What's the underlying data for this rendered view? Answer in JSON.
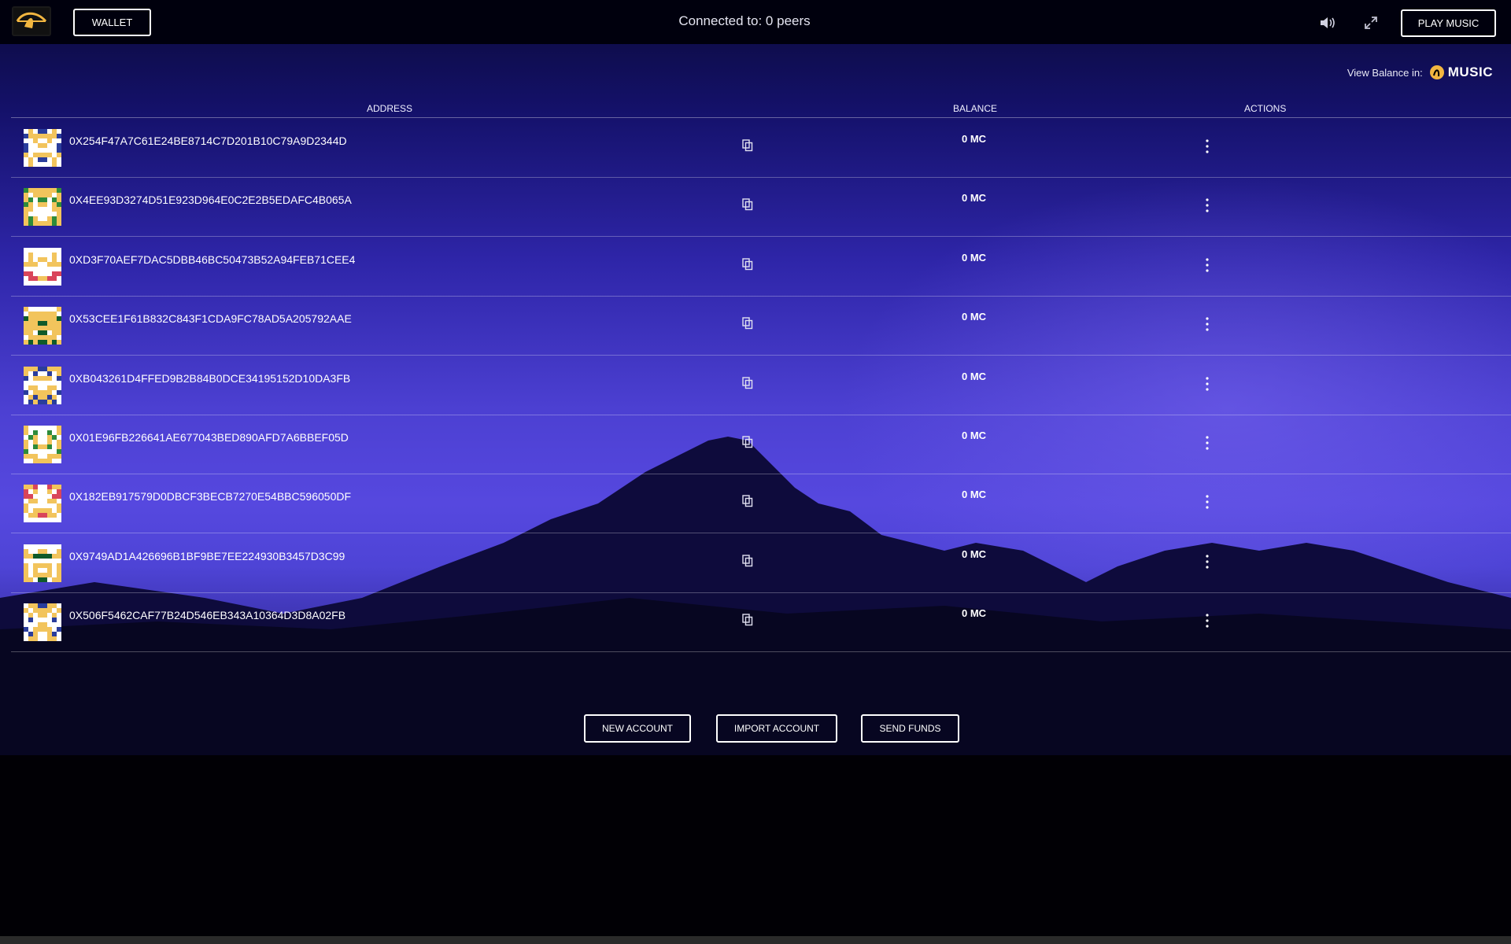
{
  "topbar": {
    "wallet_label": "WALLET",
    "peers_text": "Connected to: 0 peers",
    "play_label": "PLAY MUSIC",
    "logo_icon": "musicoin-logo-icon",
    "sound_icon": "speaker-volume-icon",
    "expand_icon": "fullscreen-expand-icon"
  },
  "balance_view": {
    "label": "View Balance in:",
    "currency_logo_text": "MUSIC"
  },
  "table": {
    "headers": {
      "address": "ADDRESS",
      "balance": "BALANCE",
      "actions": "ACTIONS"
    },
    "rows": [
      {
        "address": "0X254F47A7C61E24BE8714C7D201B10C79A9D2344D",
        "balance": "0 MC"
      },
      {
        "address": "0X4EE93D3274D51E923D964E0C2E2B5EDAFC4B065A",
        "balance": "0 MC"
      },
      {
        "address": "0XD3F70AEF7DAC5DBB46BC50473B52A94FEB71CEE4",
        "balance": "0 MC"
      },
      {
        "address": "0X53CEE1F61B832C843F1CDA9FC78AD5A205792AAE",
        "balance": "0 MC"
      },
      {
        "address": "0XB043261D4FFED9B2B84B0DCE34195152D10DA3FB",
        "balance": "0 MC"
      },
      {
        "address": "0X01E96FB226641AE677043BED890AFD7A6BBEF05D",
        "balance": "0 MC"
      },
      {
        "address": "0X182EB917579D0DBCF3BECB7270E54BBC596050DF",
        "balance": "0 MC"
      },
      {
        "address": "0X9749AD1A426696B1BF9BE7EE224930B3457D3C99",
        "balance": "0 MC"
      },
      {
        "address": "0X506F5462CAF77B24D546EB343A10364D3D8A02FB",
        "balance": "0 MC"
      }
    ]
  },
  "actions": {
    "new_account": "NEW ACCOUNT",
    "import_account": "IMPORT ACCOUNT",
    "send_funds": "SEND FUNDS"
  },
  "colors": {
    "accent_gold": "#f2b640",
    "avatar_palette": [
      "#f2c45c",
      "#2a3d9c",
      "#2e8b3a",
      "#d9455a",
      "#0f5a2a"
    ]
  }
}
